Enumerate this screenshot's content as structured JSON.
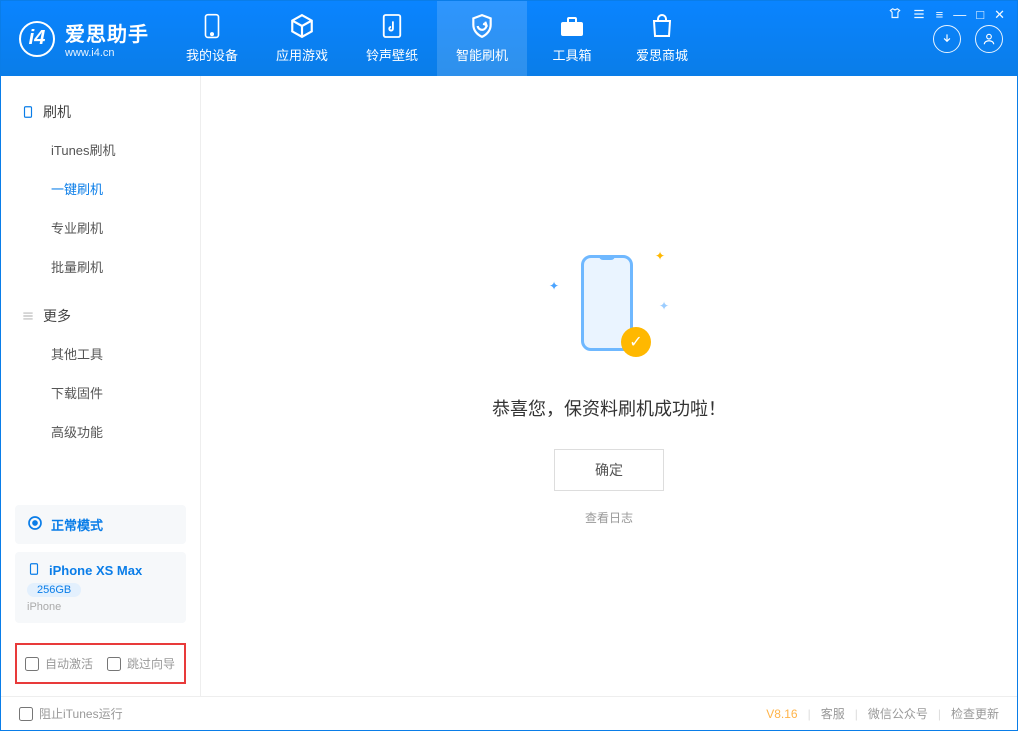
{
  "app": {
    "name_cn": "爱思助手",
    "name_en": "www.i4.cn"
  },
  "nav": {
    "items": [
      {
        "label": "我的设备"
      },
      {
        "label": "应用游戏"
      },
      {
        "label": "铃声壁纸"
      },
      {
        "label": "智能刷机"
      },
      {
        "label": "工具箱"
      },
      {
        "label": "爱思商城"
      }
    ]
  },
  "sidebar": {
    "group1": {
      "title": "刷机"
    },
    "items1": [
      {
        "label": "iTunes刷机"
      },
      {
        "label": "一键刷机"
      },
      {
        "label": "专业刷机"
      },
      {
        "label": "批量刷机"
      }
    ],
    "group2": {
      "title": "更多"
    },
    "items2": [
      {
        "label": "其他工具"
      },
      {
        "label": "下载固件"
      },
      {
        "label": "高级功能"
      }
    ]
  },
  "device": {
    "mode_label": "正常模式",
    "name": "iPhone XS Max",
    "capacity": "256GB",
    "type": "iPhone"
  },
  "options": {
    "auto_activate": "自动激活",
    "skip_guide": "跳过向导"
  },
  "main": {
    "success_msg": "恭喜您，保资料刷机成功啦！",
    "ok_label": "确定",
    "log_link": "查看日志"
  },
  "footer": {
    "block_itunes": "阻止iTunes运行",
    "version": "V8.16",
    "support": "客服",
    "wechat": "微信公众号",
    "check_update": "检查更新"
  }
}
